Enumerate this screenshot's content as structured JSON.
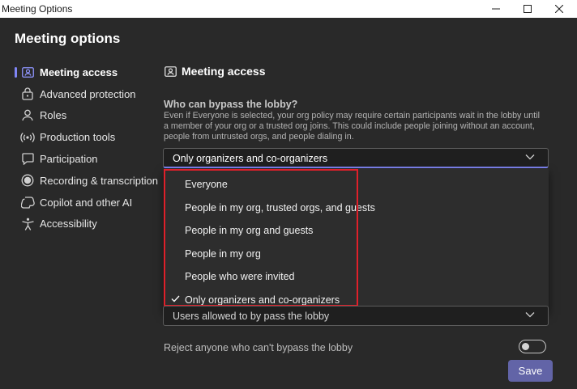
{
  "window": {
    "title": "Meeting Options"
  },
  "app": {
    "title": "Meeting options"
  },
  "nav": {
    "items": [
      {
        "label": "Meeting access",
        "icon": "person-card-icon",
        "active": true
      },
      {
        "label": "Advanced protection",
        "icon": "lock-icon",
        "active": false
      },
      {
        "label": "Roles",
        "icon": "person-icon",
        "active": false
      },
      {
        "label": "Production tools",
        "icon": "broadcast-icon",
        "active": false
      },
      {
        "label": "Participation",
        "icon": "speech-bubble-icon",
        "active": false
      },
      {
        "label": "Recording & transcription",
        "icon": "record-icon",
        "active": false
      },
      {
        "label": "Copilot and other AI",
        "icon": "copilot-icon",
        "active": false
      },
      {
        "label": "Accessibility",
        "icon": "accessibility-icon",
        "active": false
      }
    ]
  },
  "main": {
    "section_title": "Meeting access",
    "lobby": {
      "label": "Who can bypass the lobby?",
      "description": "Even if Everyone is selected, your org policy may require certain participants wait in the lobby until a member of your org or a trusted org joins. This could include people joining without an account, people from untrusted orgs, and people dialing in.",
      "selected": "Only organizers and co-organizers",
      "options": [
        {
          "label": "Everyone",
          "checked": false
        },
        {
          "label": "People in my org, trusted orgs, and guests",
          "checked": false
        },
        {
          "label": "People in my org and guests",
          "checked": false
        },
        {
          "label": "People in my org",
          "checked": false
        },
        {
          "label": "People who were invited",
          "checked": false
        },
        {
          "label": "Only organizers and co-organizers",
          "checked": true
        }
      ]
    },
    "bypass_users": {
      "value": "Users allowed to by pass the lobby"
    },
    "reject": {
      "label": "Reject anyone who can't bypass the lobby",
      "enabled": false
    },
    "save_label": "Save"
  },
  "colors": {
    "background": "#292929",
    "accent": "#6264a7",
    "focus_underline": "#7f85f5",
    "highlight_box": "#e0202a"
  }
}
